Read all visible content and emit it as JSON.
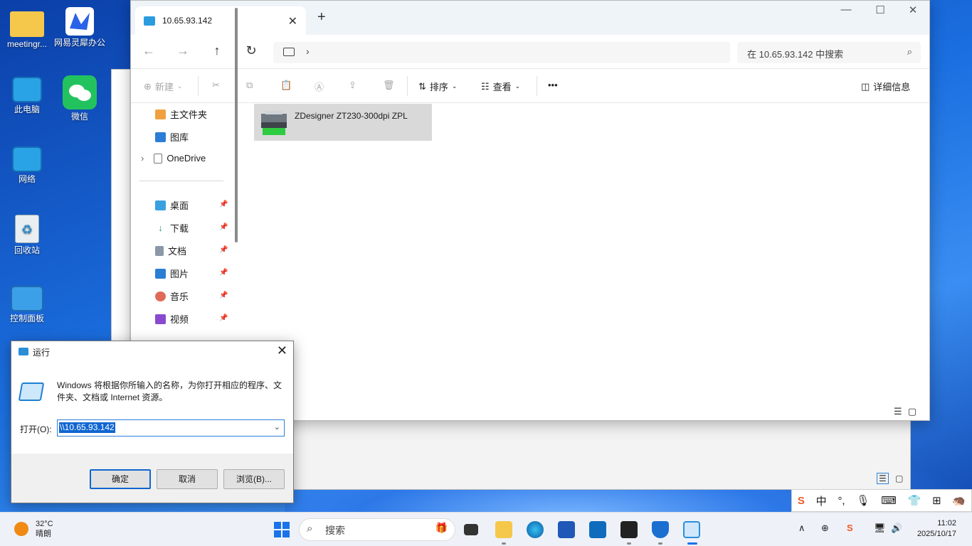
{
  "desktop": {
    "icons": [
      {
        "label": "meetingr..."
      },
      {
        "label": "网易灵犀办公"
      },
      {
        "label": "此电脑"
      },
      {
        "label": "微信"
      },
      {
        "label": "网络"
      },
      {
        "label": "回收站"
      },
      {
        "label": "控制面板"
      }
    ]
  },
  "explorer": {
    "tab_title": "10.65.93.142",
    "new_tab": "+",
    "search_placeholder": "在 10.65.93.142 中搜索",
    "commands": {
      "new": "新建",
      "sort": "排序",
      "view": "查看",
      "more": "•••",
      "details": "详细信息"
    },
    "nav": {
      "home": "主文件夹",
      "gallery": "图库",
      "onedrive": "OneDrive",
      "desktop": "桌面",
      "downloads": "下载",
      "documents": "文档",
      "pictures": "图片",
      "music": "音乐",
      "videos": "视频"
    },
    "items": [
      {
        "name": "ZDesigner ZT230-300dpi ZPL"
      }
    ]
  },
  "run_dialog": {
    "title": "运行",
    "description": "Windows 将根据你所输入的名称，为你打开相应的程序、文件夹、文档或 Internet 资源。",
    "open_label": "打开(O):",
    "input_value": "\\\\10.65.93.142",
    "ok": "确定",
    "cancel": "取消",
    "browse": "浏览(B)..."
  },
  "ime": {
    "mode": "中",
    "punct": "°,"
  },
  "taskbar": {
    "weather_temp": "32°C",
    "weather_desc": "晴朗",
    "search_label": "搜索",
    "time": "11:02",
    "date": "2025/10/17"
  }
}
